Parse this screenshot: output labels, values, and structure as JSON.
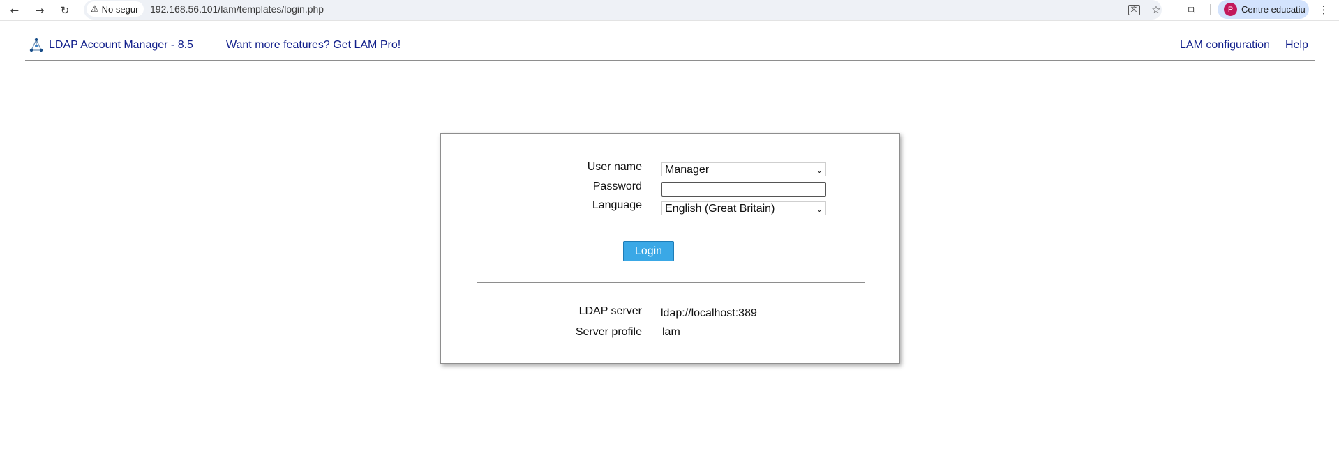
{
  "browser": {
    "security_label": "No segur",
    "url": "192.168.56.101/lam/templates/login.php",
    "profile_initial": "P",
    "profile_name": "Centre educatiu"
  },
  "header": {
    "brand": "LDAP Account Manager - 8.5",
    "promo": "Want more features? Get LAM Pro!",
    "config_link": "LAM configuration",
    "help_link": "Help"
  },
  "login": {
    "username_label": "User name",
    "username_value": "Manager",
    "password_label": "Password",
    "password_value": "",
    "language_label": "Language",
    "language_value": "English (Great Britain)",
    "login_button": "Login",
    "server_label": "LDAP server",
    "server_value": "ldap://localhost:389",
    "profile_label": "Server profile",
    "profile_value": "lam"
  },
  "colors": {
    "link": "#0f1d8a",
    "button": "#3aa8e6",
    "profile_chip": "#d3e3fd"
  }
}
